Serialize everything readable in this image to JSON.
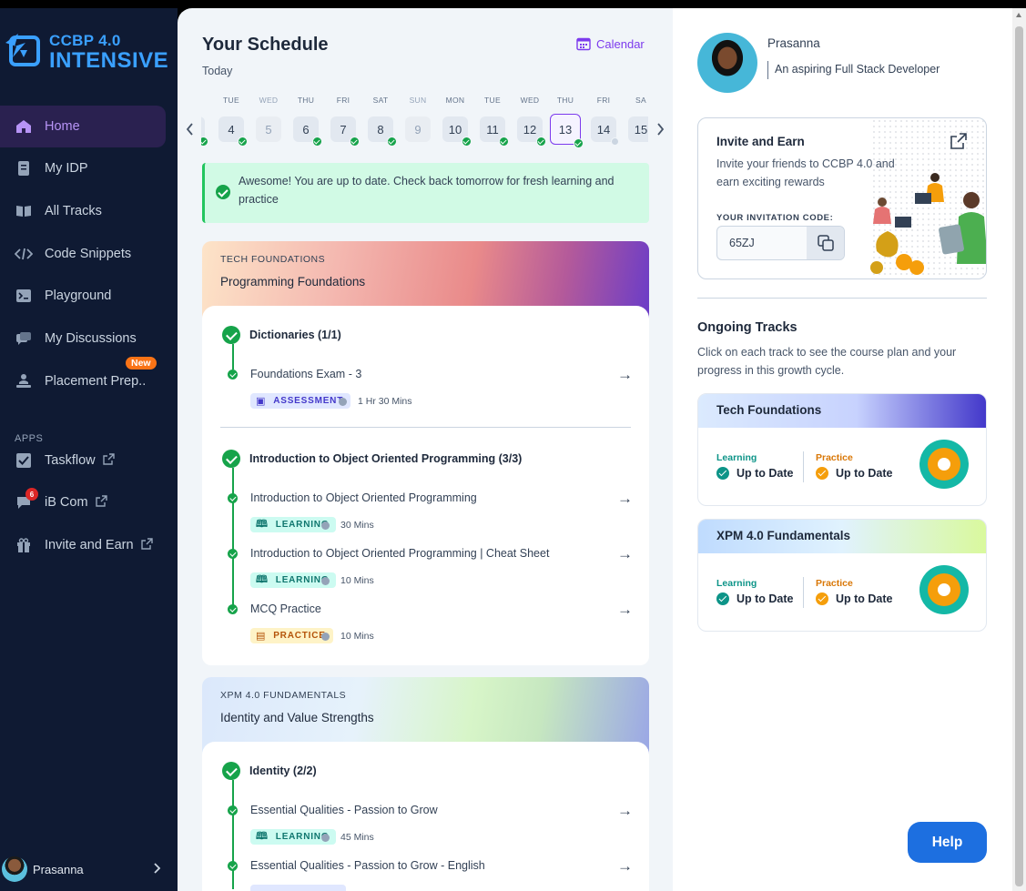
{
  "sidebar": {
    "logo_line1": "CCBP 4.0",
    "logo_line2": "INTENSIVE",
    "items": [
      {
        "label": "Home",
        "icon": "home-icon"
      },
      {
        "label": "My IDP",
        "icon": "document-icon"
      },
      {
        "label": "All Tracks",
        "icon": "book-icon"
      },
      {
        "label": "Code Snippets",
        "icon": "code-icon"
      },
      {
        "label": "Playground",
        "icon": "terminal-icon"
      },
      {
        "label": "My Discussions",
        "icon": "chat-icon"
      },
      {
        "label": "Placement Prep..",
        "icon": "person-laptop-icon"
      }
    ],
    "new_badge": "New",
    "apps_label": "APPS",
    "apps": [
      {
        "label": "Taskflow",
        "icon": "checkbox-icon"
      },
      {
        "label": "iB Com",
        "icon": "chat-bubble-icon",
        "badge": "6"
      },
      {
        "label": "Invite and Earn",
        "icon": "gift-icon"
      }
    ],
    "user_name": "Prasanna"
  },
  "schedule": {
    "title": "Your Schedule",
    "subtitle": "Today",
    "calendar_label": "Calendar",
    "days": [
      {
        "name": "",
        "num": "",
        "state": "done"
      },
      {
        "name": "TUE",
        "num": "4",
        "state": "done"
      },
      {
        "name": "WED",
        "num": "5",
        "state": "off"
      },
      {
        "name": "THU",
        "num": "6",
        "state": "done"
      },
      {
        "name": "FRI",
        "num": "7",
        "state": "done"
      },
      {
        "name": "SAT",
        "num": "8",
        "state": "done"
      },
      {
        "name": "SUN",
        "num": "9",
        "state": "off"
      },
      {
        "name": "MON",
        "num": "10",
        "state": "done"
      },
      {
        "name": "TUE",
        "num": "11",
        "state": "done"
      },
      {
        "name": "WED",
        "num": "12",
        "state": "done"
      },
      {
        "name": "THU",
        "num": "13",
        "state": "selected"
      },
      {
        "name": "FRI",
        "num": "14",
        "state": "pending"
      },
      {
        "name": "SA",
        "num": "15",
        "state": "none"
      }
    ],
    "banner": "Awesome! You are up to date. Check back tomorrow for fresh learning and practice"
  },
  "cards": [
    {
      "kicker": "TECH FOUNDATIONS",
      "title": "Programming Foundations",
      "sections": [
        {
          "title": "Dictionaries (1/1)",
          "items": [
            {
              "name": "Foundations Exam - 3",
              "tag": "ASSESSMENT",
              "duration": "1 Hr 30 Mins"
            }
          ]
        },
        {
          "title": "Introduction to Object Oriented Programming (3/3)",
          "items": [
            {
              "name": "Introduction to Object Oriented Programming",
              "tag": "LEARNING",
              "duration": "30 Mins"
            },
            {
              "name": "Introduction to Object Oriented Programming | Cheat Sheet",
              "tag": "LEARNING",
              "duration": "10 Mins"
            },
            {
              "name": "MCQ Practice",
              "tag": "PRACTICE",
              "duration": "10 Mins"
            }
          ]
        }
      ]
    },
    {
      "kicker": "XPM 4.0 FUNDAMENTALS",
      "title": "Identity and Value Strengths",
      "sections": [
        {
          "title": "Identity (2/2)",
          "items": [
            {
              "name": "Essential Qualities - Passion to Grow",
              "tag": "LEARNING",
              "duration": "45 Mins"
            },
            {
              "name": "Essential Qualities - Passion to Grow - English",
              "tag": "",
              "duration": ""
            }
          ]
        }
      ]
    }
  ],
  "profile": {
    "name": "Prasanna",
    "tagline": "An aspiring Full Stack Developer"
  },
  "invite": {
    "title": "Invite and Earn",
    "description": "Invite your friends to CCBP 4.0 and earn exciting rewards",
    "code_label": "YOUR INVITATION CODE:",
    "code": "65ZJ"
  },
  "ongoing": {
    "title": "Ongoing Tracks",
    "description": "Click on each track to see the course plan and your progress in this growth cycle.",
    "tracks": [
      {
        "name": "Tech Foundations",
        "learning_label": "Learning",
        "learning_status": "Up to Date",
        "practice_label": "Practice",
        "practice_status": "Up to Date"
      },
      {
        "name": "XPM 4.0 Fundamentals",
        "learning_label": "Learning",
        "learning_status": "Up to Date",
        "practice_label": "Practice",
        "practice_status": "Up to Date"
      }
    ]
  },
  "help_label": "Help",
  "colors": {
    "sidebar_bg": "#0f1a33",
    "accent": "#7c3aed",
    "success": "#16a34a",
    "help": "#1d6fe0"
  }
}
